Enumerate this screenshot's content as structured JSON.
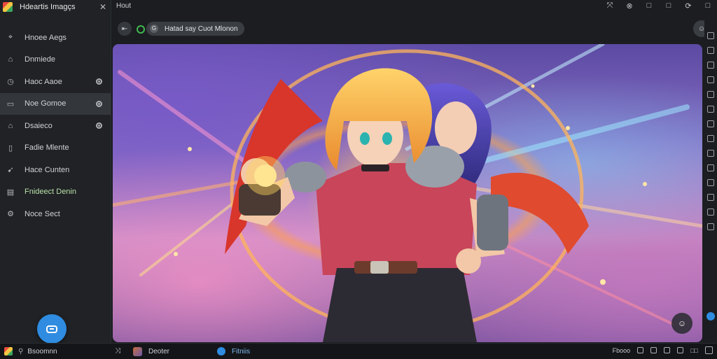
{
  "app": {
    "title": "Hdeartis Imagçs"
  },
  "topbar": {
    "tab_label": "Hout",
    "controls": [
      "⤧",
      "⊗",
      "□",
      "□",
      "⟳",
      "□"
    ]
  },
  "sidebar": {
    "items": [
      {
        "label": "Hnoee Aegs",
        "icon": "pin-icon",
        "eye": false,
        "active": false
      },
      {
        "label": "Dnmiede",
        "icon": "home-icon",
        "eye": false,
        "active": false
      },
      {
        "label": "Haoc Aaoe",
        "icon": "clock-icon",
        "eye": true,
        "active": false
      },
      {
        "label": "Noe Gomoe",
        "icon": "monitor-icon",
        "eye": true,
        "active": true
      },
      {
        "label": "Dsaieco",
        "icon": "house-icon",
        "eye": true,
        "active": false
      },
      {
        "label": "Fadie Mlente",
        "icon": "document-icon",
        "eye": false,
        "active": false
      },
      {
        "label": "Hace Cunten",
        "icon": "send-icon",
        "eye": false,
        "active": false
      },
      {
        "label": "Fnideect Denin",
        "icon": "chart-icon",
        "eye": false,
        "active": false
      },
      {
        "label": "Noce Sect",
        "icon": "gear-icon",
        "eye": false,
        "active": false
      }
    ]
  },
  "address": {
    "back": "⇤",
    "secondary": "G",
    "text": "Hatad say Cuot Mlonon",
    "right_icon": "☺"
  },
  "viewer": {
    "button_icon": "☺"
  },
  "taskbar": {
    "app_label": "Bsoomnn",
    "shuffle_icon": "⤨",
    "window1": "Deoter",
    "window2": "Fitniis",
    "tray_text": "Fbooo",
    "tray_extra": "□□"
  },
  "colors": {
    "accent": "#2f8ce0",
    "sidebar_bg": "#202225",
    "active_bg": "#33363b",
    "green": "#3fb950"
  }
}
